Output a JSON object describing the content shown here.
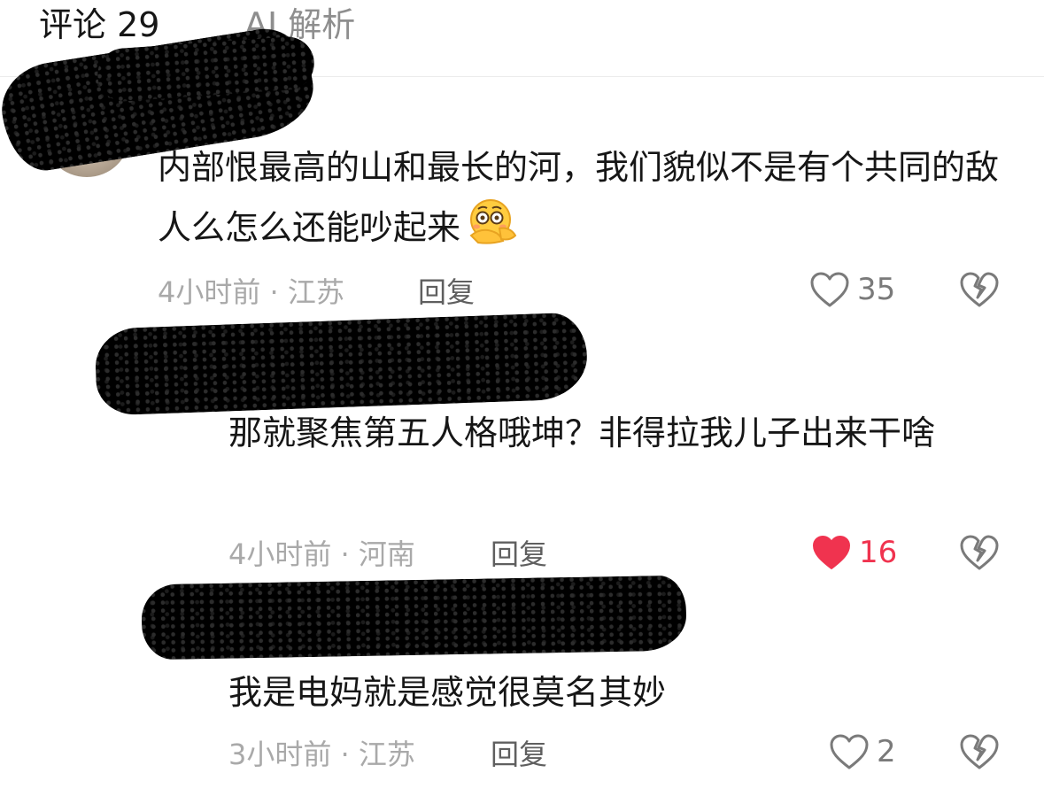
{
  "tabs": {
    "comments_label": "评论 29",
    "ai_label": "AI 解析"
  },
  "comments": [
    {
      "text": "内部恨最高的山和最长的河，我们貌似不是有个共同的敌人么怎么还能吵起来",
      "emoji": "flushed-face-hand-over-mouth",
      "meta": "4小时前 · 江苏",
      "reply_label": "回复",
      "likes": "35",
      "liked": false
    },
    {
      "text": "那就聚焦第五人格哦坤？非得拉我儿子出来干啥",
      "meta": "4小时前 · 河南",
      "reply_label": "回复",
      "likes": "16",
      "liked": true
    },
    {
      "text": "我是电妈就是感觉很莫名其妙",
      "meta": "3小时前 · 江苏",
      "reply_label": "回复",
      "likes": "2",
      "liked": false
    }
  ],
  "colors": {
    "liked_heart": "#f0334f",
    "icon_gray": "#8a8a8a",
    "meta_gray": "#a9a9a9"
  },
  "icons": {
    "like": "heart-icon",
    "liked": "heart-filled-icon",
    "dislike": "broken-heart-icon"
  }
}
